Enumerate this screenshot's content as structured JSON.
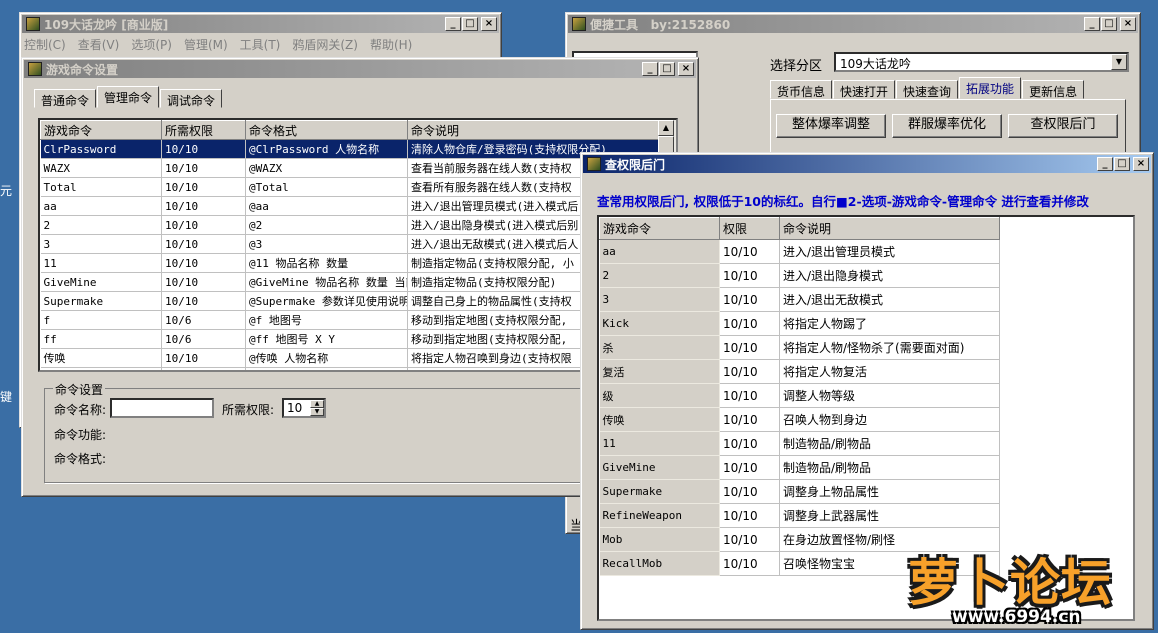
{
  "desktop": {
    "edge_chars": [
      "元",
      "键"
    ]
  },
  "main_window": {
    "title": "109大话龙吟 [商业版]",
    "menu": [
      "控制(C)",
      "查看(V)",
      "选项(P)",
      "管理(M)",
      "工具(T)",
      "鸦盾网关(Z)",
      "帮助(H)"
    ]
  },
  "cmd_window": {
    "title": "游戏命令设置",
    "tabs": [
      "普通命令",
      "管理命令",
      "调试命令"
    ],
    "selected_tab": 1,
    "columns": [
      "游戏命令",
      "所需权限",
      "命令格式",
      "命令说明"
    ],
    "rows": [
      [
        "ClrPassword",
        "10/10",
        "@ClrPassword 人物名称",
        "清除人物仓库/登录密码(支持权限分配)"
      ],
      [
        "WAZX",
        "10/10",
        "@WAZX",
        "查看当前服务器在线人数(支持权"
      ],
      [
        "Total",
        "10/10",
        "@Total",
        "查看所有服务器在线人数(支持权"
      ],
      [
        "aa",
        "10/10",
        "@aa",
        "进入/退出管理员模式(进入模式后"
      ],
      [
        "2",
        "10/10",
        "@2",
        "进入/退出隐身模式(进入模式后别"
      ],
      [
        "3",
        "10/10",
        "@3",
        "进入/退出无敌模式(进入模式后人"
      ],
      [
        "11",
        "10/10",
        "@11 物品名称 数量",
        "制造指定物品(支持权限分配, 小"
      ],
      [
        "GiveMine",
        "10/10",
        "@GiveMine 物品名称 数量 当前",
        "制造指定物品(支持权限分配)"
      ],
      [
        "Supermake",
        "10/10",
        "@Supermake 参数详见使用说明",
        "调整自己身上的物品属性(支持权"
      ],
      [
        "f",
        "10/6",
        "@f 地图号",
        "移动到指定地图(支持权限分配,"
      ],
      [
        "ff",
        "10/6",
        "@ff 地图号 X Y",
        "移动到指定地图(支持权限分配,"
      ],
      [
        "传唤",
        "10/10",
        "@传唤 人物名称",
        "将指定人物召唤到身边(支持权限"
      ],
      [
        "",
        "",
        "",
        ""
      ]
    ],
    "selected_row": 0,
    "group_title": "命令设置",
    "name_label": "命令名称:",
    "name_value": "",
    "perm_label": "所需权限:",
    "perm_value": "10",
    "func_label": "命令功能:",
    "format_label": "命令格式:"
  },
  "tools_window": {
    "title": "便捷工具",
    "author": "by:2152860",
    "zone_label": "选择分区",
    "zone_value": "109大话龙吟",
    "tabs": [
      "货币信息",
      "快速打开",
      "快速查询",
      "拓展功能",
      "更新信息"
    ],
    "selected_tab": 3,
    "buttons": [
      "整体爆率调整",
      "群服爆率优化",
      "查权限后门"
    ],
    "cut_label": "当"
  },
  "perm_window": {
    "title": "查权限后门",
    "notice": "查常用权限后门, 权限低于10的标红。自行■2-选项-游戏命令-管理命令  进行查看并修改",
    "columns": [
      "游戏命令",
      "权限",
      "命令说明"
    ],
    "rows": [
      [
        "aa",
        "10/10",
        "进入/退出管理员模式"
      ],
      [
        "2",
        "10/10",
        "进入/退出隐身模式"
      ],
      [
        "3",
        "10/10",
        "进入/退出无敌模式"
      ],
      [
        "Kick",
        "10/10",
        "将指定人物踢了"
      ],
      [
        "杀",
        "10/10",
        "将指定人物/怪物杀了(需要面对面)"
      ],
      [
        "复活",
        "10/10",
        "将指定人物复活"
      ],
      [
        "级",
        "10/10",
        "调整人物等级"
      ],
      [
        "传唤",
        "10/10",
        "召唤人物到身边"
      ],
      [
        "11",
        "10/10",
        "制造物品/刷物品"
      ],
      [
        "GiveMine",
        "10/10",
        "制造物品/刷物品"
      ],
      [
        "Supermake",
        "10/10",
        "调整身上物品属性"
      ],
      [
        "RefineWeapon",
        "10/10",
        "调整身上武器属性"
      ],
      [
        "Mob",
        "10/10",
        "在身边放置怪物/刷怪"
      ],
      [
        "RecallMob",
        "10/10",
        "召唤怪物宝宝"
      ]
    ]
  },
  "watermark": {
    "name": "萝卜论坛",
    "url": "www.6994.cn"
  }
}
